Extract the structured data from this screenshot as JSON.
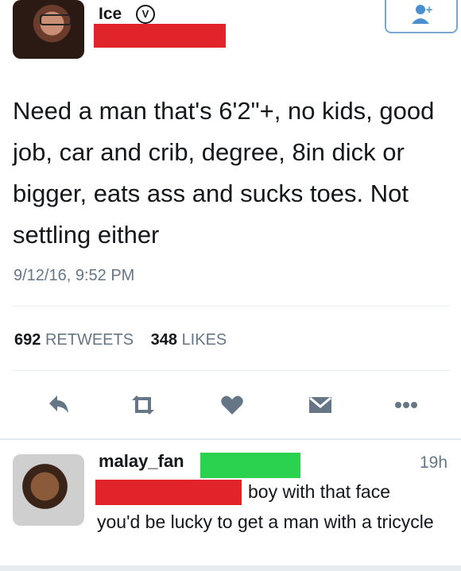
{
  "tweet": {
    "author": {
      "name": "Ice",
      "verified_glyph": "V",
      "avatar_icon": "profile-photo"
    },
    "text": "Need a man that's 6'2\"+, no kids, good job, car and crib, degree, 8in dick or bigger, eats ass and sucks toes. Not settling either",
    "timestamp": "9/12/16, 9:52 PM",
    "retweets_count": "692",
    "retweets_label": "RETWEETS",
    "likes_count": "348",
    "likes_label": "LIKES",
    "actions": [
      "reply-icon",
      "retweet-icon",
      "heart-icon",
      "direct-message-icon",
      "more-icon"
    ],
    "colors": {
      "action_gray": "#657786",
      "redaction_red": "#e0242a",
      "redaction_green": "#2bd24f",
      "follow_blue": "#4a8fd0"
    }
  },
  "reply": {
    "author": "malay_fan",
    "time": "19h",
    "text_line1": "boy with that face",
    "text_rest": "you'd be lucky to get a man with a tricycle"
  }
}
